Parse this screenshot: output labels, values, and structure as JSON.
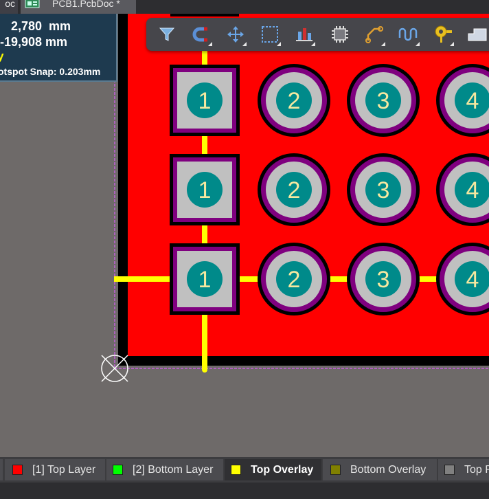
{
  "document_tabs": [
    {
      "label": "oc"
    },
    {
      "label": "PCB1.PcbDoc *"
    }
  ],
  "hud": {
    "x_readout": "  2,780  mm",
    "y_readout": "-19,908 mm",
    "mark": "y",
    "hotspot_snap": "otspot Snap: 0.203mm"
  },
  "toolbar": {
    "tools": [
      {
        "name": "filter-icon"
      },
      {
        "name": "snap-magnet-icon"
      },
      {
        "name": "move-icon"
      },
      {
        "name": "select-rectangle-icon"
      },
      {
        "name": "align-icon"
      },
      {
        "name": "component-icon"
      },
      {
        "name": "route-icon"
      },
      {
        "name": "interactive-tuning-icon"
      },
      {
        "name": "pad-via-icon"
      },
      {
        "name": "polygon-pour-icon"
      }
    ]
  },
  "pcb": {
    "pad_labels": [
      "1",
      "2",
      "3",
      "4"
    ],
    "board_color": "#ff0000",
    "pad_color": "#c0c0c0",
    "hole_color": "#008a8a",
    "overlay_color": "#ffff00",
    "ring_color": "#7f007f"
  },
  "layers": [
    {
      "label": "[1] Top Layer",
      "color": "#ff0000",
      "active": false
    },
    {
      "label": "[2] Bottom Layer",
      "color": "#00ff00",
      "active": false
    },
    {
      "label": "Top Overlay",
      "color": "#ffff00",
      "active": true
    },
    {
      "label": "Bottom Overlay",
      "color": "#808000",
      "active": false
    },
    {
      "label": "Top P",
      "color": "#808080",
      "active": false
    }
  ]
}
